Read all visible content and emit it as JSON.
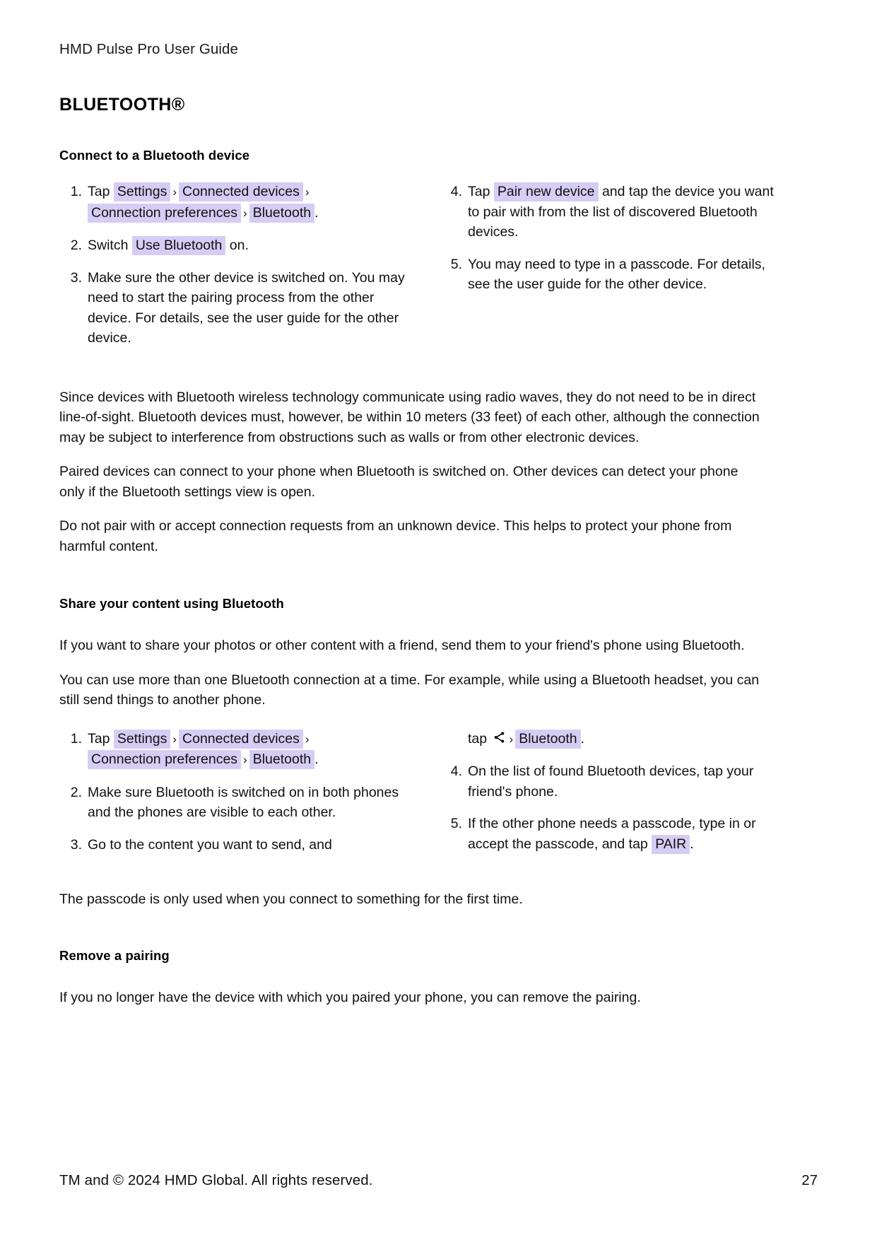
{
  "document": {
    "running_head": "HMD Pulse Pro User Guide",
    "chapter_title": "BLUETOOTH®"
  },
  "section_connect": {
    "heading": "Connect to a Bluetooth device",
    "step1": {
      "num": "1.",
      "lead": "Tap",
      "chip_settings": "Settings",
      "sep1": "›",
      "chip_connected_devices": "Connected devices",
      "sep2": "›",
      "chip_connection_preferences": "Connection preferences",
      "sep3": "›",
      "chip_bluetooth": "Bluetooth",
      "period": "."
    },
    "step2": {
      "num": "2.",
      "lead": "Switch",
      "chip_use_bluetooth": "Use Bluetooth",
      "tail": "on."
    },
    "step3": {
      "num": "3.",
      "text": "Make sure the other device is switched on. You may need to start the pairing process from the other device. For details, see the user guide for the other device."
    },
    "step4": {
      "num": "4.",
      "lead": "Tap",
      "chip_pair_new_device": "Pair new device",
      "tail": "and tap the device you want to pair with from the list of discovered Bluetooth devices."
    },
    "step5": {
      "num": "5.",
      "text": "You may need to type in a passcode. For details, see the user guide for the other device."
    }
  },
  "paragraphs_connect": {
    "p1": "Since devices with Bluetooth wireless technology communicate using radio waves, they do not need to be in direct line-of-sight. Bluetooth devices must, however, be within 10 meters (33 feet) of each other, although the connection may be subject to interference from obstructions such as walls or from other electronic devices.",
    "p2": "Paired devices can connect to your phone when Bluetooth is switched on. Other devices can detect your phone only if the Bluetooth settings view is open.",
    "p3": "Do not pair with or accept connection requests from an unknown device. This helps to protect your phone from harmful content."
  },
  "section_share": {
    "heading": "Share your content using Bluetooth",
    "p1": "If you want to share your photos or other content with a friend, send them to your friend's phone using Bluetooth.",
    "p2": "You can use more than one Bluetooth connection at a time. For example, while using a Bluetooth headset, you can still send things to another phone.",
    "step1": {
      "num": "1.",
      "lead": "Tap",
      "chip_settings": "Settings",
      "sep1": "›",
      "chip_connected_devices": "Connected devices",
      "sep2": "›",
      "chip_connection_preferences": "Connection preferences",
      "sep3": "›",
      "chip_bluetooth": "Bluetooth",
      "period": "."
    },
    "step2": {
      "num": "2.",
      "text": "Make sure Bluetooth is switched on in both phones and the phones are visible to each other."
    },
    "step3": {
      "num": "3.",
      "text": "Go to the content you want to send, and"
    },
    "step3_cont": {
      "lead": "tap",
      "icon": "share-icon",
      "sep": "›",
      "chip_bluetooth": "Bluetooth",
      "period": "."
    },
    "step4": {
      "num": "4.",
      "text": "On the list of found Bluetooth devices, tap your friend's phone."
    },
    "step5": {
      "num": "5.",
      "lead": "If the other phone needs a passcode, type in or accept the passcode, and tap",
      "chip_pair": "PAIR",
      "period": "."
    },
    "p3": "The passcode is only used when you connect to something for the first time."
  },
  "section_remove": {
    "heading": "Remove a pairing",
    "p1": "If you no longer have the device with which you paired your phone, you can remove the pairing."
  },
  "footer": {
    "copyright": "TM and © 2024 HMD Global. All rights reserved.",
    "page_number": "27"
  },
  "colors": {
    "chip_background": "#d6cdf5",
    "text": "#111111",
    "page_background": "#ffffff"
  }
}
